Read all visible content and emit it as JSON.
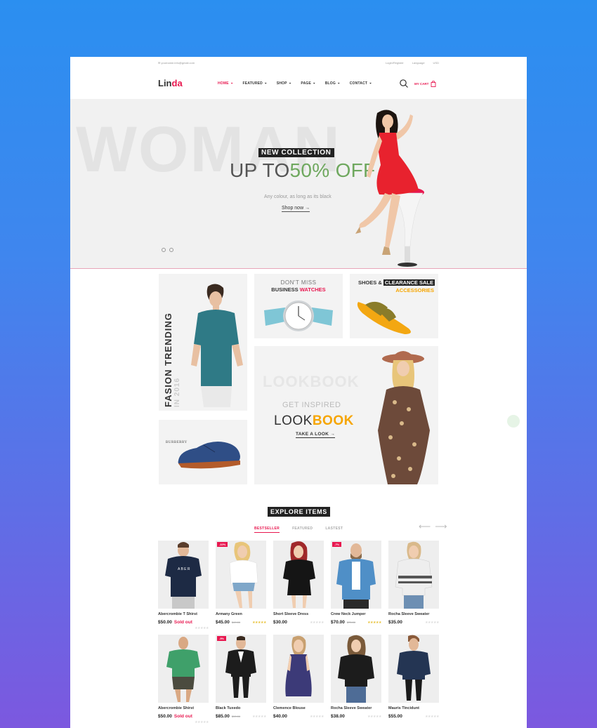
{
  "topbar": {
    "email": "✉  yourname.info@gmail.com",
    "login": "Login/Register",
    "language": "Language",
    "currency": "USD"
  },
  "header": {
    "logo_main": "Lin",
    "logo_accent": "da",
    "nav": [
      {
        "label": "HOME"
      },
      {
        "label": "FEATURED"
      },
      {
        "label": "SHOP"
      },
      {
        "label": "PAGE"
      },
      {
        "label": "BLOG"
      },
      {
        "label": "CONTACT"
      }
    ],
    "cart_label": "MY CART"
  },
  "hero": {
    "bg_word": "WOMAN",
    "badge": "NEW COLLECTION",
    "title_main": "UP TO",
    "title_accent": "50% OFF",
    "subtitle": "Any colour, as long as its black",
    "link": "Shop now  →"
  },
  "banners": {
    "fashion_title": "FASION TRENDING",
    "fashion_sub": "IN 2016",
    "watch_line1": "DON'T MISS",
    "watch_line2": "BUSINESS ",
    "watch_accent": "WATCHES",
    "shoes_line1": "SHOES & ",
    "shoes_inv": "CLEARANCE SALE",
    "shoes_accent": "ACCESSORIES",
    "shoe_brand": "BURBERRY",
    "lookbook_bg": "LOOKBOOK",
    "lookbook_sub": "GET INSPIRED",
    "lookbook_main": "LOOK",
    "lookbook_accent": "BOOK",
    "lookbook_link": "TAKE A LOOK  →"
  },
  "explore": {
    "title": "EXPLORE ITEMS",
    "tabs": [
      "BESTSELLER",
      "FEATURED",
      "LASTEST"
    ],
    "prev": "⟵",
    "next": "⟶"
  },
  "products": [
    {
      "name": "Abercrombie T Shirst",
      "price": "$50.00",
      "old": "",
      "soldout": "Sold out",
      "sale": "",
      "stars": "★★★★★",
      "rated": false
    },
    {
      "name": "Armany Green",
      "price": "$45.00",
      "old": "$49.00",
      "soldout": "",
      "sale": "-10%",
      "stars": "★★★★★",
      "rated": true
    },
    {
      "name": "Short Sleeve Dress",
      "price": "$30.00",
      "old": "",
      "soldout": "",
      "sale": "",
      "stars": "★★★★★",
      "rated": false
    },
    {
      "name": "Crew Neck Jumper",
      "price": "$70.00",
      "old": "$75.00",
      "soldout": "",
      "sale": "-7%",
      "stars": "★★★★★",
      "rated": true
    },
    {
      "name": "Rocha Sleeve Sweater",
      "price": "$35.00",
      "old": "",
      "soldout": "",
      "sale": "",
      "stars": "★★★★★",
      "rated": false
    },
    {
      "name": "Abercrombie Shirst",
      "price": "$50.00",
      "old": "",
      "soldout": "Sold out",
      "sale": "",
      "stars": "★★★★★",
      "rated": false
    },
    {
      "name": "Black Tuxedo",
      "price": "$85.00",
      "old": "$90.00",
      "soldout": "",
      "sale": "-5%",
      "stars": "★★★★★",
      "rated": false
    },
    {
      "name": "Clemence Blouse",
      "price": "$40.00",
      "old": "",
      "soldout": "",
      "sale": "",
      "stars": "★★★★★",
      "rated": false
    },
    {
      "name": "Rocha Sleeve Sweater",
      "price": "$38.00",
      "old": "",
      "soldout": "",
      "sale": "",
      "stars": "★★★★★",
      "rated": false
    },
    {
      "name": "Mauris Tincidunt",
      "price": "$55.00",
      "old": "",
      "soldout": "",
      "sale": "",
      "stars": "★★★★★",
      "rated": false
    }
  ],
  "colors": {
    "accent": "#e8174f",
    "green": "#6fa85f",
    "orange": "#f6a500",
    "dark": "#222222"
  }
}
